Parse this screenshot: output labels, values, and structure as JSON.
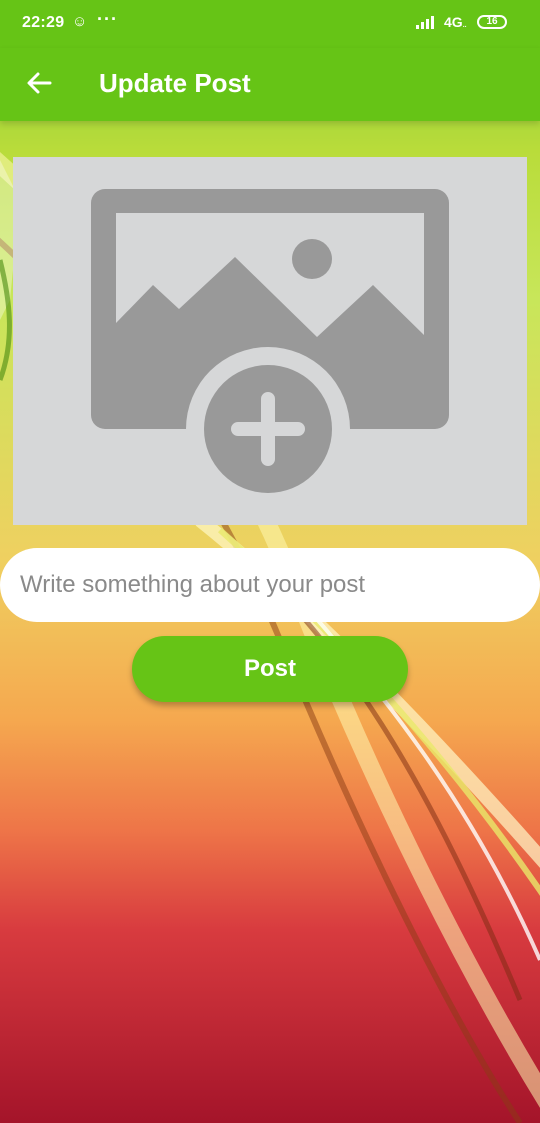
{
  "status_bar": {
    "time": "22:29",
    "app_icon": "uc-browser-icon",
    "more": "···",
    "network": "4G",
    "network_sub": "..",
    "battery": "16"
  },
  "app_bar": {
    "title": "Update Post",
    "back_icon": "arrow-left-icon"
  },
  "image_picker": {
    "icon": "add-photo-icon"
  },
  "description_input": {
    "placeholder": "Write something about your post",
    "value": ""
  },
  "post_button": {
    "label": "Post"
  },
  "colors": {
    "primary": "#66c416",
    "picker_bg": "#d6d7d8",
    "icon_gray": "#999999"
  }
}
